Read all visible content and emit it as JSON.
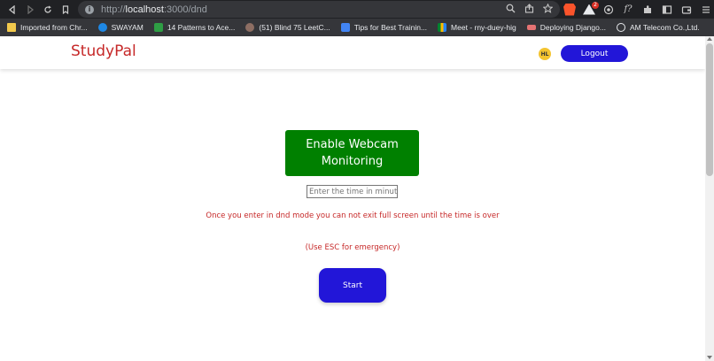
{
  "browser": {
    "url_scheme": "http://",
    "url_host": "localhost",
    "url_path": ":3000/dnd",
    "nav_back": "‹",
    "nav_forward": "›",
    "nav_reload": "↻",
    "extension_badge_1": "9",
    "extension_badge_2": "2"
  },
  "bookmarks": [
    {
      "label": "Imported from Chr...",
      "icon": "folder-icon"
    },
    {
      "label": "SWAYAM",
      "icon": "swayam-icon"
    },
    {
      "label": "14 Patterns to Ace...",
      "icon": "leetcode-icon"
    },
    {
      "label": "(51) Blind 75 LeetC...",
      "icon": "blind-icon"
    },
    {
      "label": "Tips for Best Trainin...",
      "icon": "tips-icon"
    },
    {
      "label": "Meet - rny-duey-hig",
      "icon": "meet-icon"
    },
    {
      "label": "Deploying Django...",
      "icon": "django-icon"
    },
    {
      "label": "AM Telecom Co.,Ltd.",
      "icon": "globe-icon"
    }
  ],
  "header": {
    "logo": "StudyPal",
    "avatar_initials": "HL",
    "logout_label": "Logout"
  },
  "main": {
    "webcam_button_label": "Enable Webcam Monitoring",
    "time_placeholder": "Enter the time in minut",
    "warning_text": "Once you enter in dnd mode you can not exit full screen until the time is over",
    "esc_text": "(Use ESC for emergency)",
    "start_label": "Start"
  },
  "colors": {
    "brand_red": "#c62828",
    "primary_blue": "#2216d8",
    "webcam_green": "#008000"
  }
}
